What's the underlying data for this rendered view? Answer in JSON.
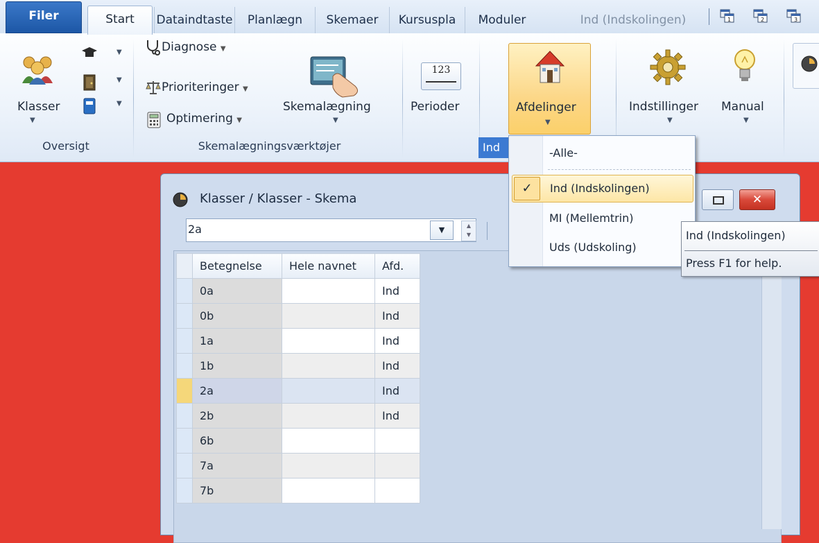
{
  "tabs": {
    "file": "Filer",
    "start": "Start",
    "items": [
      "Dataindtaste",
      "Planlægn",
      "Skemaer",
      "Kursuspla",
      "Moduler"
    ],
    "context": "Ind (Indskolingen)"
  },
  "ribbon": {
    "oversigt": {
      "klasser_label": "Klasser",
      "group_label": "Oversigt"
    },
    "tools": {
      "diagnose": "Diagnose",
      "prioriteringer": "Prioriteringer",
      "optimering": "Optimering",
      "skemalaegning": "Skemalægning",
      "group_label": "Skemalægningsværktøjer"
    },
    "perioder": {
      "label": "Perioder",
      "icon_text": "123"
    },
    "afdelinger": {
      "label": "Afdelinger",
      "group_label": "Ind"
    },
    "indstillinger": "Indstillinger",
    "manual": "Manual"
  },
  "window": {
    "title": "Klasser / Klasser - Skema",
    "combo_value": "2a",
    "columns": [
      "Betegnelse",
      "Hele navnet",
      "Afd."
    ],
    "rows": [
      {
        "betegnelse": "0a",
        "navn": "",
        "afd": "Ind"
      },
      {
        "betegnelse": "0b",
        "navn": "",
        "afd": "Ind"
      },
      {
        "betegnelse": "1a",
        "navn": "",
        "afd": "Ind"
      },
      {
        "betegnelse": "1b",
        "navn": "",
        "afd": "Ind"
      },
      {
        "betegnelse": "2a",
        "navn": "",
        "afd": "Ind",
        "selected": true
      },
      {
        "betegnelse": "2b",
        "navn": "",
        "afd": "Ind"
      },
      {
        "betegnelse": "6b",
        "navn": "",
        "afd": ""
      },
      {
        "betegnelse": "7a",
        "navn": "",
        "afd": ""
      },
      {
        "betegnelse": "7b",
        "navn": "",
        "afd": ""
      }
    ]
  },
  "dropdown": {
    "items": [
      {
        "label": "-Alle-",
        "checked": false
      },
      {
        "label": "Ind (Indskolingen)",
        "checked": true
      },
      {
        "label": "MI (Mellemtrin)",
        "checked": false
      },
      {
        "label": "Uds (Udskoling)",
        "checked": false
      }
    ],
    "check_glyph": "✓"
  },
  "tooltip": {
    "title": "Ind (Indskolingen)",
    "help": "Press F1 for help."
  },
  "colors": {
    "desktop": "#e53b30",
    "file_tab": "#1d57a6",
    "highlight": "#fbd98a"
  }
}
